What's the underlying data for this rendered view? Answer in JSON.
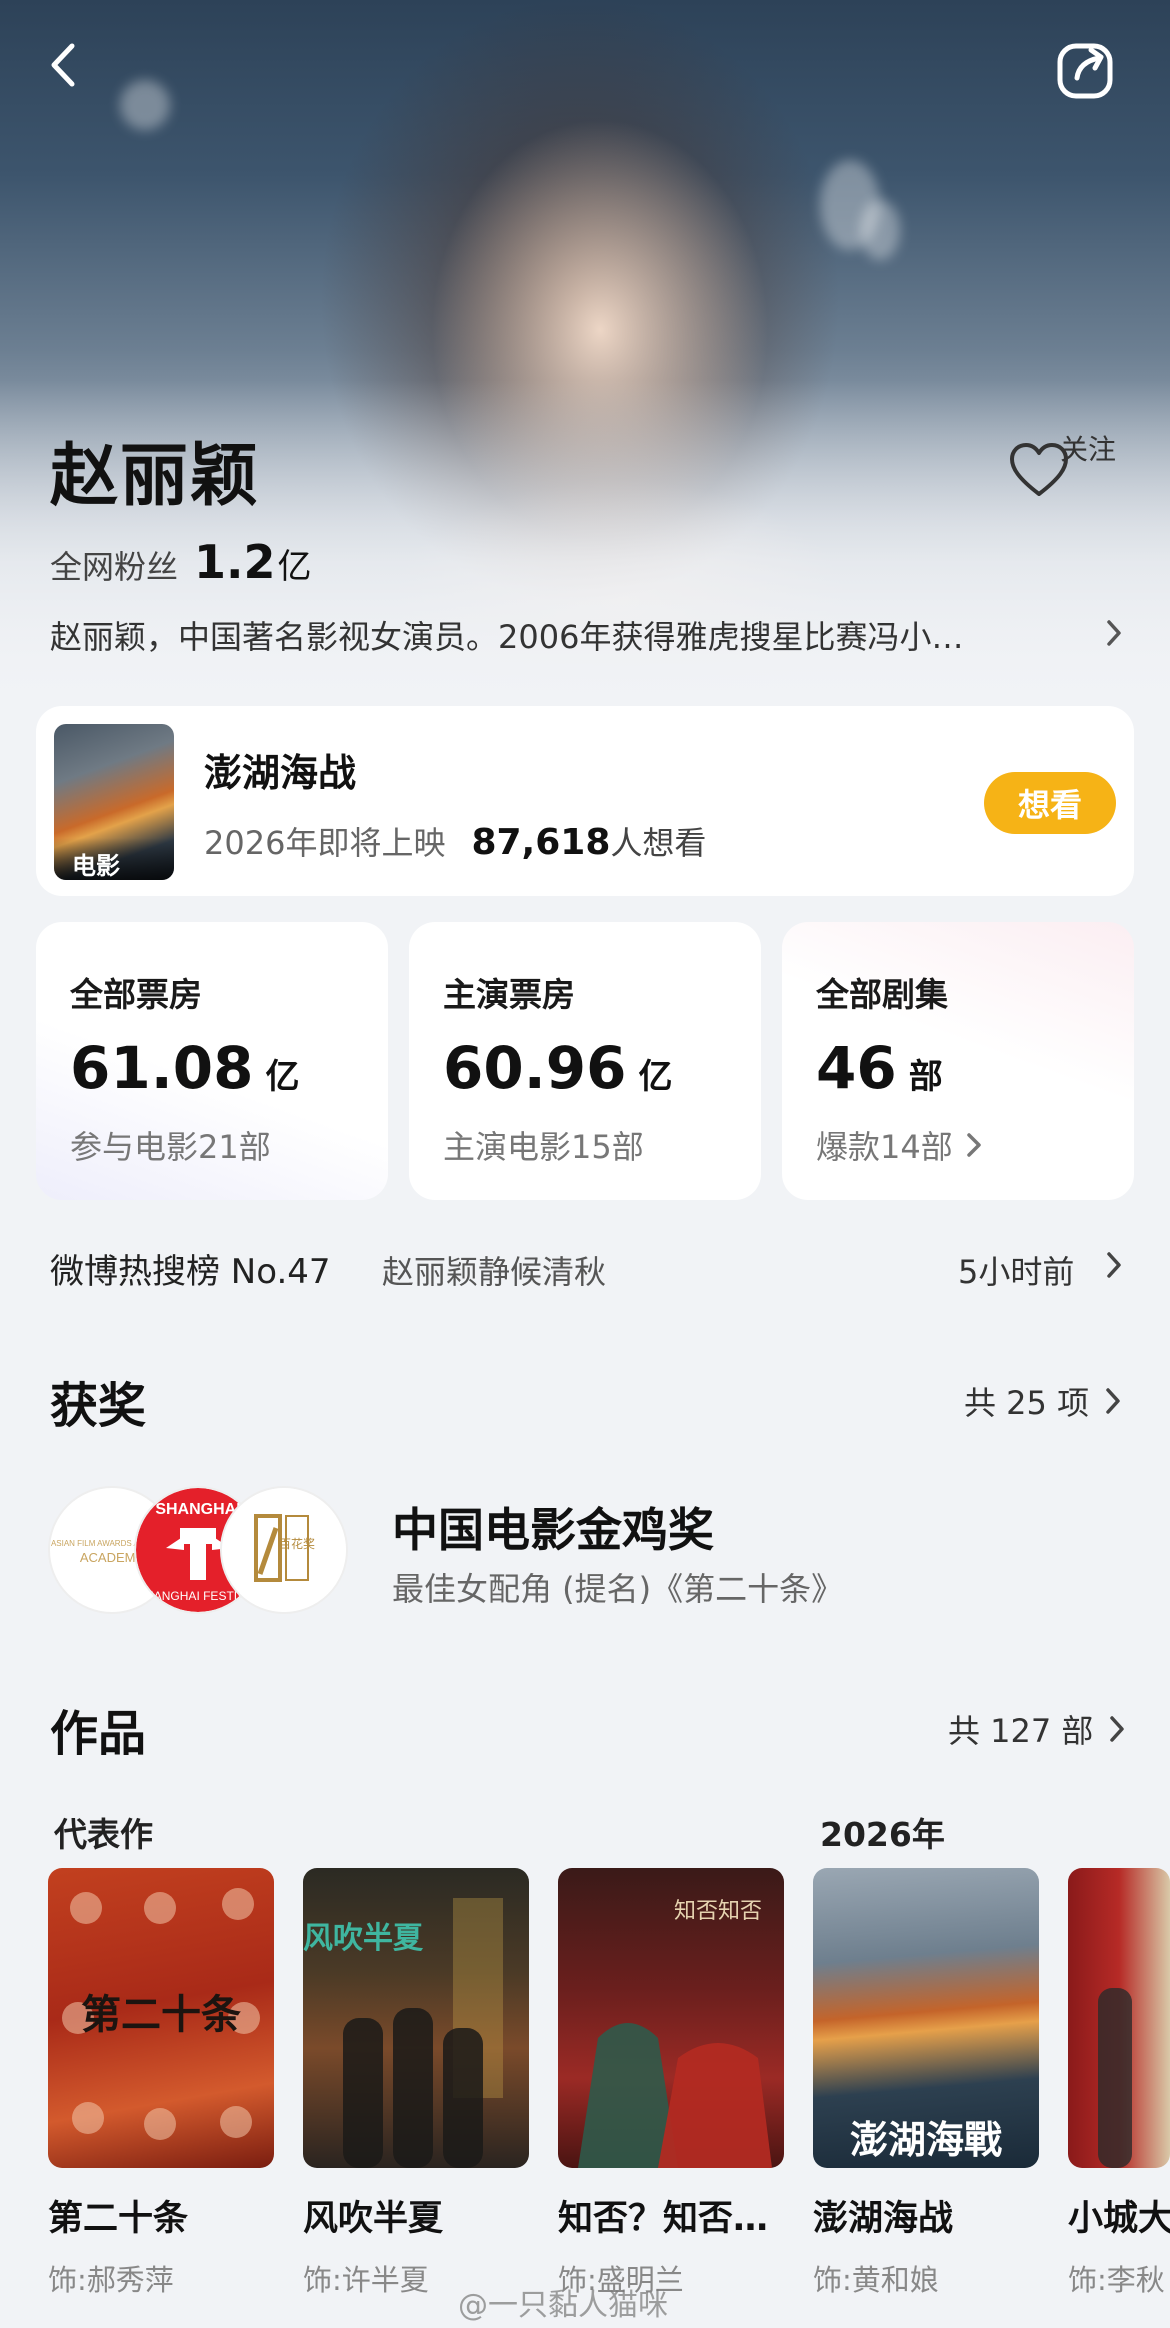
{
  "header": {
    "back_icon": "chevron-left-icon",
    "share_icon": "share-icon"
  },
  "profile": {
    "name": "赵丽颖",
    "follow_label": "关注",
    "fans_label": "全网粉丝",
    "fans_value": "1.2",
    "fans_unit": "亿",
    "bio": "赵丽颖，中国著名影视女演员。2006年获得雅虎搜星比赛冯小…"
  },
  "upcoming": {
    "poster_tag": "电影",
    "title": "澎湖海战",
    "status": "2026年即将上映",
    "count": "87,618",
    "count_unit": "人想看",
    "button": "想看"
  },
  "stats": [
    {
      "title": "全部票房",
      "value": "61.08",
      "unit": "亿",
      "sub": "参与电影21部"
    },
    {
      "title": "主演票房",
      "value": "60.96",
      "unit": "亿",
      "sub": "主演电影15部"
    },
    {
      "title": "全部剧集",
      "value": "46",
      "unit": "部",
      "sub": "爆款14部"
    }
  ],
  "hot_search": {
    "rank": "微博热搜榜 No.47",
    "topic": "赵丽颖静候清秋",
    "time": "5小时前"
  },
  "awards": {
    "title": "获奖",
    "count": "共 25 项",
    "name": "中国电影金鸡奖",
    "desc": "最佳女配角 (提名)《第二十条》",
    "logo1_text": "ASIAN FILM AWARDS ACADEMY",
    "logo2_text": "SHANGHAI FESTIVAL",
    "logo3_text": "百花奖"
  },
  "works": {
    "title": "作品",
    "count": "共 127 部",
    "group1": "代表作",
    "group2": "2026年",
    "items": [
      {
        "title": "第二十条",
        "role": "饰:郝秀萍",
        "poster_text": "第二十条"
      },
      {
        "title": "风吹半夏",
        "role": "饰:许半夏",
        "poster_text": "风吹半夏"
      },
      {
        "title": "知否？知否…",
        "role": "饰:盛明兰",
        "poster_text": "知否知否"
      },
      {
        "title": "澎湖海战",
        "role": "饰:黄和娘",
        "poster_text": "澎湖海戰"
      },
      {
        "title": "小城大",
        "role": "饰:李秋",
        "poster_text": ""
      }
    ]
  },
  "watermark": "@一只黏人猫咪",
  "colors": {
    "accent": "#f6b316",
    "background": "#f1f3f6"
  }
}
